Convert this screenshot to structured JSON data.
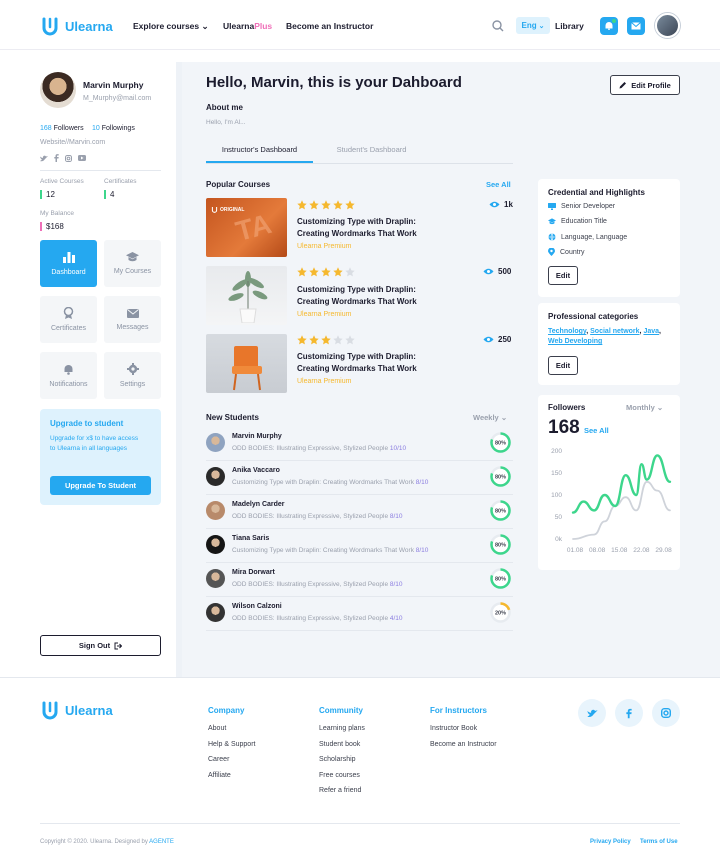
{
  "header": {
    "logo_text": "Ulearna",
    "nav": {
      "explore": "Explore courses",
      "plus_prefix": "Ulearna",
      "plus_suffix": "Plus",
      "instructor": "Become an Instructor"
    },
    "lang": "Eng",
    "library": "Library"
  },
  "sidebar": {
    "user_name": "Marvin Murphy",
    "user_email": "M_Murphy@mail.com",
    "followers_count": "168",
    "followers_label": "Followers",
    "followings_count": "10",
    "followings_label": "Followings",
    "website": "Website//Marvin.com",
    "active_courses_label": "Active Courses",
    "active_courses": "12",
    "certificates_label": "Certificates",
    "certificates": "4",
    "balance_label": "My Balance",
    "balance": "$168",
    "tiles": [
      {
        "label": "Dashboard",
        "icon": "chart-icon"
      },
      {
        "label": "My Courses",
        "icon": "graduation-cap-icon"
      },
      {
        "label": "Certificates",
        "icon": "award-icon"
      },
      {
        "label": "Messages",
        "icon": "envelope-icon"
      },
      {
        "label": "Notifications",
        "icon": "bell-icon"
      },
      {
        "label": "Settings",
        "icon": "gear-icon"
      }
    ],
    "upgrade": {
      "title": "Upgrade to student",
      "text": "Upgrade for x$ to have access to Ulearna in all languages",
      "button": "Upgrade To Student"
    },
    "sign_out": "Sign Out"
  },
  "main": {
    "greeting": "Hello, Marvin, this is your Dahboard",
    "edit_profile": "Edit Profile",
    "about_title": "About me",
    "about_text": "Hello, I'm Al...",
    "tabs": [
      "Instructor's Dashboard",
      "Student's Dashboard"
    ],
    "popular_title": "Popular Courses",
    "see_all": "See All",
    "courses": [
      {
        "title": "Customizing Type with Draplin: Creating Wordmarks That Work",
        "sub": "Ulearna Premium",
        "views": "1k",
        "rating": 5,
        "badge": "ORIGINAL"
      },
      {
        "title": "Customizing Type with Draplin: Creating Wordmarks That Work",
        "sub": "Ulearna Premium",
        "views": "500",
        "rating": 4
      },
      {
        "title": "Customizing Type with Draplin: Creating Wordmarks That Work",
        "sub": "Ulearna Premium",
        "views": "250",
        "rating": 3
      }
    ],
    "new_students_title": "New Students",
    "weekly": "Weekly",
    "students": [
      {
        "name": "Marvin Murphy",
        "desc": "ODD BODIES: Illustrating Expressive, Stylized People",
        "progress": "10/10",
        "percent": "80%",
        "value": 0.8
      },
      {
        "name": "Anika Vaccaro",
        "desc": "Customizing Type with Draplin: Creating Wordmarks That Work",
        "progress": "8/10",
        "percent": "80%",
        "value": 0.8
      },
      {
        "name": "Madelyn Carder",
        "desc": "ODD BODIES: Illustrating Expressive, Stylized People",
        "progress": "8/10",
        "percent": "80%",
        "value": 0.8
      },
      {
        "name": "Tiana Saris",
        "desc": "Customizing Type with Draplin: Creating Wordmarks That Work",
        "progress": "8/10",
        "percent": "80%",
        "value": 0.8
      },
      {
        "name": "Mira Dorwart",
        "desc": "ODD BODIES: Illustrating Expressive, Stylized People",
        "progress": "8/10",
        "percent": "80%",
        "value": 0.8
      },
      {
        "name": "Wilson Calzoni",
        "desc": "ODD BODIES: Illustrating Expressive, Stylized People",
        "progress": "4/10",
        "percent": "20%",
        "value": 0.2
      }
    ],
    "credentials": {
      "title": "Credential and Highlights",
      "items": [
        {
          "text": "Senior Developer",
          "icon": "monitor-icon"
        },
        {
          "text": "Education Title",
          "icon": "graduation-cap-icon"
        },
        {
          "text": "Language, Language",
          "icon": "globe-icon"
        },
        {
          "text": "Country",
          "icon": "location-pin-icon"
        }
      ],
      "edit": "Edit"
    },
    "professional": {
      "title": "Professional categories",
      "tags": [
        "Technology",
        "Social network",
        "Java",
        "Web Developing"
      ],
      "edit": "Edit"
    },
    "followers": {
      "title": "Followers",
      "period": "Monthly",
      "count": "168",
      "see_all": "See All"
    }
  },
  "chart_data": {
    "type": "line",
    "title": "Followers",
    "x": [
      "01.08",
      "08.08",
      "15.08",
      "22.08",
      "29.08"
    ],
    "ylim": [
      0,
      200
    ],
    "yticks": [
      "200",
      "150",
      "100",
      "50",
      "0k"
    ],
    "series": [
      {
        "color": "#3dd68c",
        "points": [
          [
            0,
            60
          ],
          [
            0.5,
            85
          ],
          [
            1,
            65
          ],
          [
            1.5,
            100
          ],
          [
            2,
            75
          ],
          [
            2.5,
            145
          ],
          [
            3,
            100
          ],
          [
            3.25,
            170
          ],
          [
            3.5,
            135
          ],
          [
            4,
            190
          ],
          [
            4.6,
            130
          ]
        ]
      },
      {
        "color": "#cfd3da",
        "points": [
          [
            0,
            0
          ],
          [
            1,
            10
          ],
          [
            1.5,
            40
          ],
          [
            2,
            75
          ],
          [
            2.5,
            95
          ],
          [
            3,
            65
          ],
          [
            3.5,
            130
          ],
          [
            4,
            110
          ],
          [
            4.6,
            65
          ]
        ]
      }
    ]
  },
  "footer": {
    "logo_text": "Ulearna",
    "company_title": "Company",
    "company_links": [
      "About",
      "Help & Support",
      "Career",
      "Affiliate"
    ],
    "community_title": "Community",
    "community_links": [
      "Learning plans",
      "Student book",
      "Scholarship",
      "Free courses",
      "Refer a friend"
    ],
    "instructors_title": "For Instructors",
    "instructors_links": [
      "Instructor Book",
      "Become an Instructor"
    ],
    "copyright": "Copyright © 2020. Ulearna. Designed by",
    "designer": "AGENTE",
    "privacy": "Privacy Policy",
    "terms": "Terms of Use"
  },
  "colors": {
    "accent": "#25a8f0",
    "green": "#3dd68c",
    "star": "#f5b82e",
    "pink": "#ef6fb8"
  }
}
